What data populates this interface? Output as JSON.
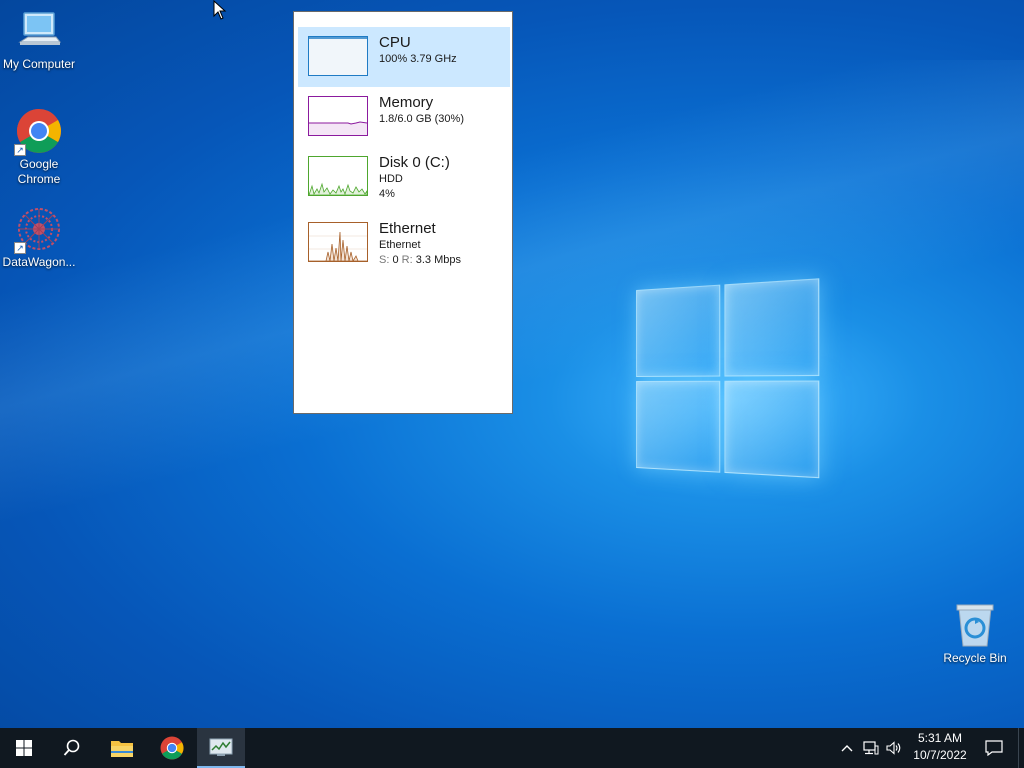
{
  "desktop": {
    "icons": [
      {
        "label": "My Computer"
      },
      {
        "label": "Google Chrome"
      },
      {
        "label": "DataWagon..."
      },
      {
        "label": "Recycle Bin"
      }
    ]
  },
  "task_manager": {
    "items": [
      {
        "title": "CPU",
        "line1": "100%  3.79 GHz",
        "selected": true,
        "color": "#1f7bc4"
      },
      {
        "title": "Memory",
        "line1": "1.8/6.0 GB (30%)",
        "color": "#8b1a9e"
      },
      {
        "title": "Disk 0 (C:)",
        "line1": "HDD",
        "line2": "4%",
        "color": "#4ea72e"
      },
      {
        "title": "Ethernet",
        "line1": "Ethernet",
        "line2_send_label": "S:",
        "line2_send_value": "0",
        "line2_recv_label": "R:",
        "line2_recv_value": "3.3 Mbps",
        "color": "#a7602a"
      }
    ]
  },
  "taskbar": {
    "clock_time": "5:31 AM",
    "clock_date": "10/7/2022",
    "pinned": [
      "start-icon",
      "search-icon",
      "file-explorer-icon",
      "chrome-icon",
      "task-manager-icon"
    ]
  },
  "colors": {
    "taskbar_bg": "#101820",
    "selected_bg": "#cce8ff"
  }
}
